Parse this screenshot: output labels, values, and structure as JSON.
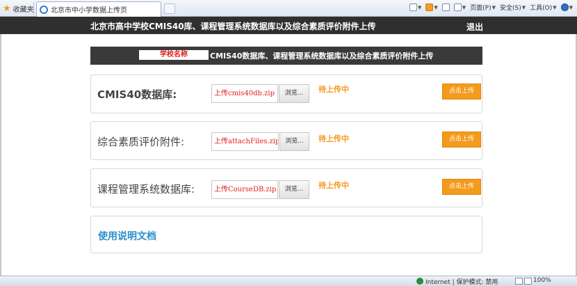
{
  "browser": {
    "favorites_label": "收藏夹",
    "tab_title": "北京市中小学数据上传页",
    "toolbar": {
      "page_menu": "页面(P)",
      "safety_menu": "安全(S)",
      "tools_menu": "工具(O)"
    }
  },
  "header": {
    "title": "北京市高中学校CMIS40库、课程管理系统数据库以及综合素质评价附件上传",
    "logout_label": "退出"
  },
  "banner": {
    "school_name": "学校名称",
    "text": "CMIS40数据库、课程管理系统数据库以及综合素质评价附件上传"
  },
  "uploads": [
    {
      "label": "CMIS40数据库:",
      "file_value": "上传cmis40db.zip",
      "browse_label": "浏览...",
      "status": "待上传中",
      "button_label": "点击上传"
    },
    {
      "label": "综合素质评价附件:",
      "file_value": "上传attachFiles.zip",
      "browse_label": "浏览...",
      "status": "待上传中",
      "button_label": "点击上传"
    },
    {
      "label": "课程管理系统数据库:",
      "file_value": "上传CourseDB.zip",
      "browse_label": "浏览...",
      "status": "待上传中",
      "button_label": "点击上传"
    }
  ],
  "help": {
    "link_label": "使用说明文档"
  },
  "statusbar": {
    "zone_text": "Internet | 保护模式: 禁用",
    "zoom": "100%"
  },
  "colors": {
    "header_bg": "#2f2f2f",
    "accent_orange": "#f39b1b",
    "link_blue": "#2d8fc9",
    "file_text_red": "#e51b1b"
  }
}
